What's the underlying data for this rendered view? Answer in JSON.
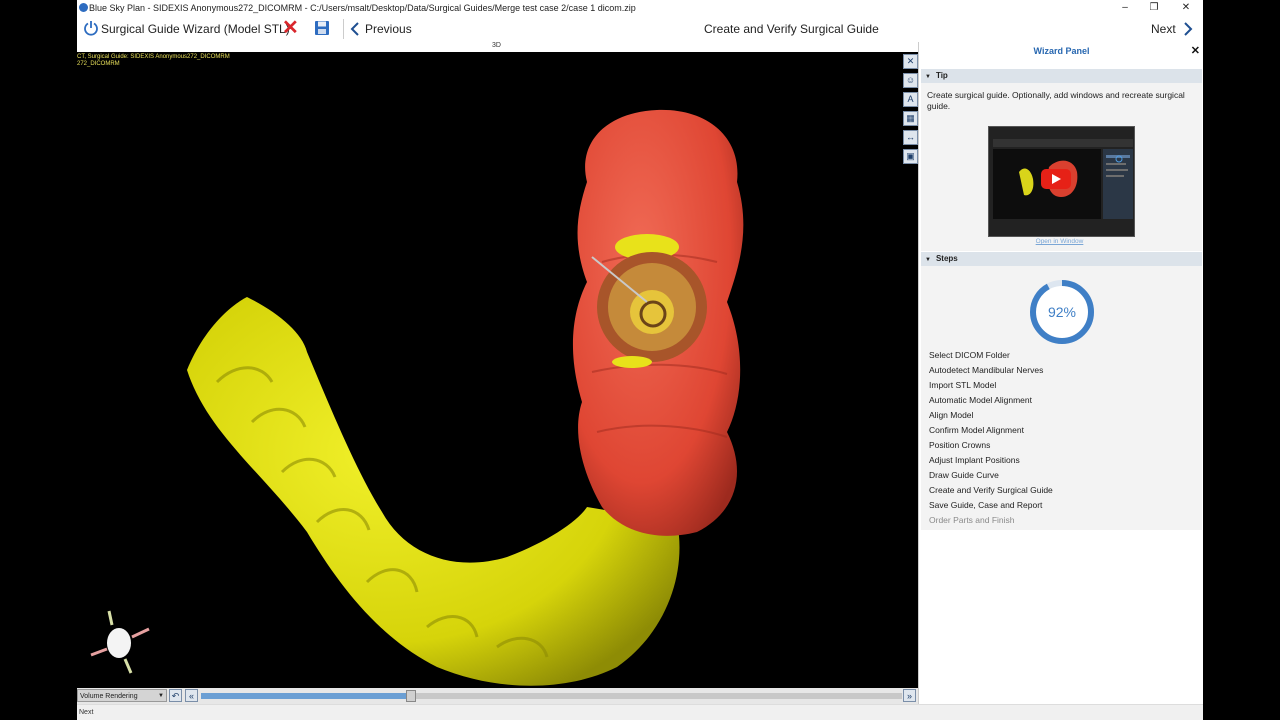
{
  "window": {
    "title": "Blue Sky Plan - SIDEXIS Anonymous272_DICOMRM - C:/Users/msalt/Desktop/Data/Surgical Guides/Merge test case 2/case 1 dicom.zip",
    "minimize": "–",
    "restore": "❐",
    "close": "✕"
  },
  "toolbar": {
    "wizard_title": "Surgical Guide Wizard (Model STL)",
    "previous_label": "Previous",
    "step_title": "Create and Verify Surgical Guide",
    "next_label": "Next"
  },
  "viewport": {
    "view_label": "3D",
    "info_line1": "CT, Surgical Guide: SIDEXIS Anonymous272_DICOMRM",
    "info_line2": "272_DICOMRM",
    "render_mode": "Volume Rendering",
    "slider_progress": 0.3
  },
  "status": {
    "text": "Next"
  },
  "wizard": {
    "title": "Wizard Panel",
    "tip": {
      "header": "Tip",
      "text": "Create surgical guide. Optionally, add windows and recreate surgical guide.",
      "open_link": "Open in Window"
    },
    "steps_section": {
      "header": "Steps",
      "progress_label": "92%",
      "progress_value": 0.92,
      "items": [
        {
          "label": "Select DICOM Folder",
          "enabled": true
        },
        {
          "label": "Autodetect Mandibular Nerves",
          "enabled": true
        },
        {
          "label": "Import STL Model",
          "enabled": true
        },
        {
          "label": "Automatic Model Alignment",
          "enabled": true
        },
        {
          "label": "Align Model",
          "enabled": true
        },
        {
          "label": "Confirm Model Alignment",
          "enabled": true
        },
        {
          "label": "Position Crowns",
          "enabled": true
        },
        {
          "label": "Adjust Implant Positions",
          "enabled": true
        },
        {
          "label": "Draw Guide Curve",
          "enabled": true
        },
        {
          "label": "Create and Verify Surgical Guide",
          "enabled": true
        },
        {
          "label": "Save Guide, Case and Report",
          "enabled": true
        },
        {
          "label": "Order Parts and Finish",
          "enabled": false
        }
      ]
    }
  },
  "colors": {
    "accent": "#2767b0",
    "guide_red": "#e24a3a",
    "model_yellow": "#e3e210",
    "progress_ring": "#3f7fc6"
  }
}
